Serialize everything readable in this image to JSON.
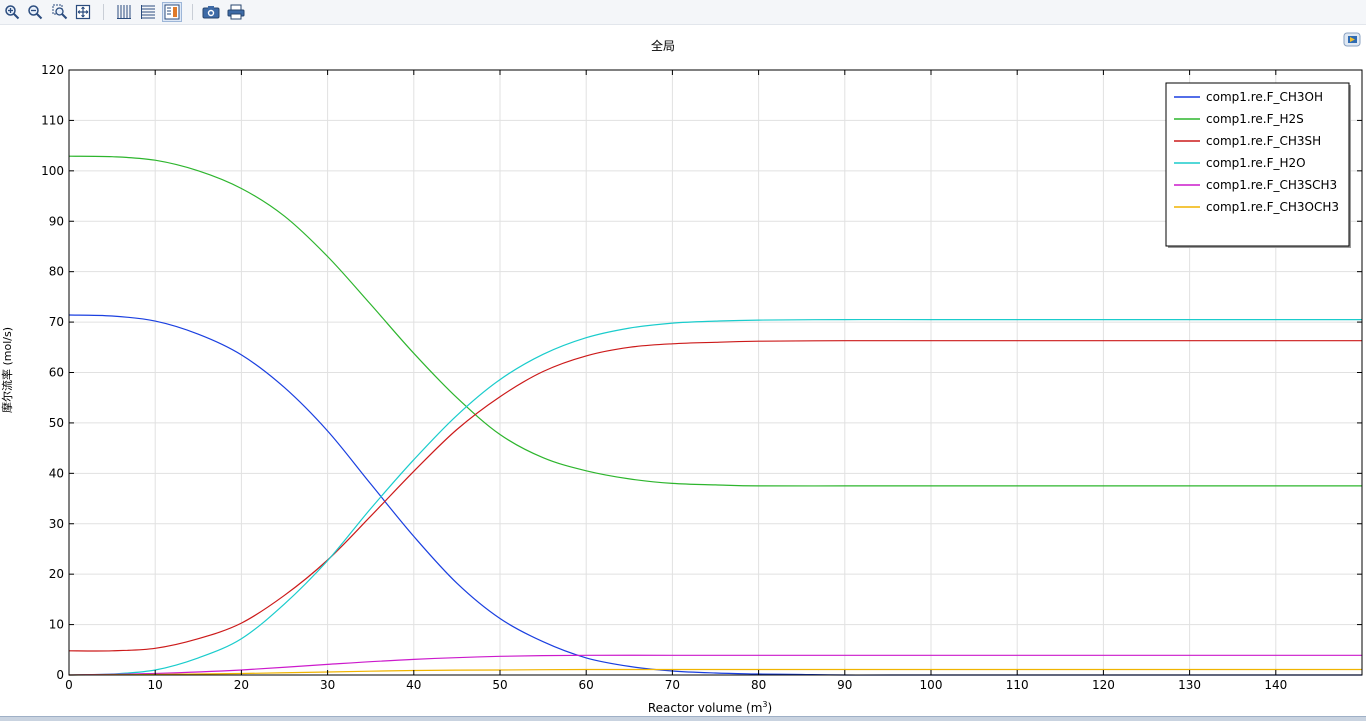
{
  "toolbar": {
    "items": [
      {
        "name": "zoom-in-icon"
      },
      {
        "name": "zoom-out-icon"
      },
      {
        "name": "zoom-box-icon"
      },
      {
        "name": "zoom-extents-icon"
      },
      {
        "name": "x-grid-icon"
      },
      {
        "name": "y-grid-icon"
      },
      {
        "name": "legend-toggle-icon"
      },
      {
        "name": "camera-icon"
      },
      {
        "name": "print-icon"
      }
    ]
  },
  "colors": {
    "grid": "#e1e1e1",
    "axis": "#000000"
  },
  "chart_data": {
    "type": "line",
    "title": "全局",
    "xlabel": "Reactor volume (m",
    "xlabel_sup": "3",
    "xlabel_tail": ")",
    "ylabel": "摩尔流率 (mol/s)",
    "xlim": [
      0,
      150
    ],
    "ylim": [
      0,
      120
    ],
    "xticks": [
      0,
      10,
      20,
      30,
      40,
      50,
      60,
      70,
      80,
      90,
      100,
      110,
      120,
      130,
      140
    ],
    "yticks": [
      0,
      10,
      20,
      30,
      40,
      50,
      60,
      70,
      80,
      90,
      100,
      110,
      120
    ],
    "grid": true,
    "legend_position": "top-right",
    "series": [
      {
        "name": "comp1.re.F_CH3OH",
        "color": "#1a3fe0",
        "x": [
          0,
          5,
          10,
          15,
          20,
          25,
          30,
          35,
          40,
          45,
          50,
          55,
          60,
          65,
          70,
          75,
          80,
          85,
          90,
          100,
          150
        ],
        "y": [
          71.4,
          71.2,
          70.2,
          67.6,
          63.5,
          57,
          48.4,
          37.9,
          27.5,
          18.2,
          11.2,
          6.6,
          3.4,
          1.7,
          0.8,
          0.4,
          0.2,
          0.1,
          0,
          0,
          0
        ]
      },
      {
        "name": "comp1.re.F_H2S",
        "color": "#2db52d",
        "x": [
          0,
          5,
          10,
          15,
          20,
          25,
          30,
          35,
          40,
          45,
          50,
          55,
          60,
          65,
          70,
          75,
          80,
          90,
          100,
          150
        ],
        "y": [
          102.9,
          102.8,
          102.1,
          100,
          96.5,
          91,
          83,
          73.5,
          63.8,
          55,
          47.7,
          43.1,
          40.5,
          38.9,
          38,
          37.7,
          37.5,
          37.5,
          37.5,
          37.5
        ]
      },
      {
        "name": "comp1.re.F_CH3SH",
        "color": "#cc1a1a",
        "x": [
          0,
          5,
          10,
          15,
          20,
          25,
          30,
          35,
          40,
          45,
          50,
          55,
          60,
          65,
          70,
          75,
          80,
          90,
          100,
          150
        ],
        "y": [
          4.8,
          4.8,
          5.3,
          7.2,
          10.3,
          15.8,
          22.8,
          31.5,
          40.4,
          48.7,
          55.2,
          60.2,
          63.3,
          65,
          65.7,
          66,
          66.2,
          66.3,
          66.3,
          66.3
        ]
      },
      {
        "name": "comp1.re.F_H2O",
        "color": "#1acccc",
        "x": [
          0,
          5,
          10,
          15,
          20,
          25,
          30,
          35,
          40,
          45,
          50,
          55,
          60,
          65,
          70,
          75,
          80,
          90,
          100,
          150
        ],
        "y": [
          0,
          0.2,
          1,
          3.4,
          7.2,
          14.1,
          22.7,
          33,
          42.7,
          51.5,
          58.6,
          63.6,
          66.9,
          68.8,
          69.8,
          70.2,
          70.4,
          70.5,
          70.5,
          70.5
        ]
      },
      {
        "name": "comp1.re.F_CH3SCH3",
        "color": "#cc1acc",
        "x": [
          0,
          10,
          20,
          30,
          40,
          50,
          60,
          70,
          80,
          150
        ],
        "y": [
          0,
          0.3,
          1,
          2.1,
          3.1,
          3.7,
          3.9,
          3.9,
          3.9,
          3.9
        ]
      },
      {
        "name": "comp1.re.F_CH3OCH3",
        "color": "#f0b400",
        "x": [
          0,
          10,
          20,
          30,
          40,
          50,
          60,
          70,
          150
        ],
        "y": [
          0,
          0.1,
          0.3,
          0.6,
          0.9,
          1,
          1.1,
          1.1,
          1.1
        ]
      }
    ]
  }
}
